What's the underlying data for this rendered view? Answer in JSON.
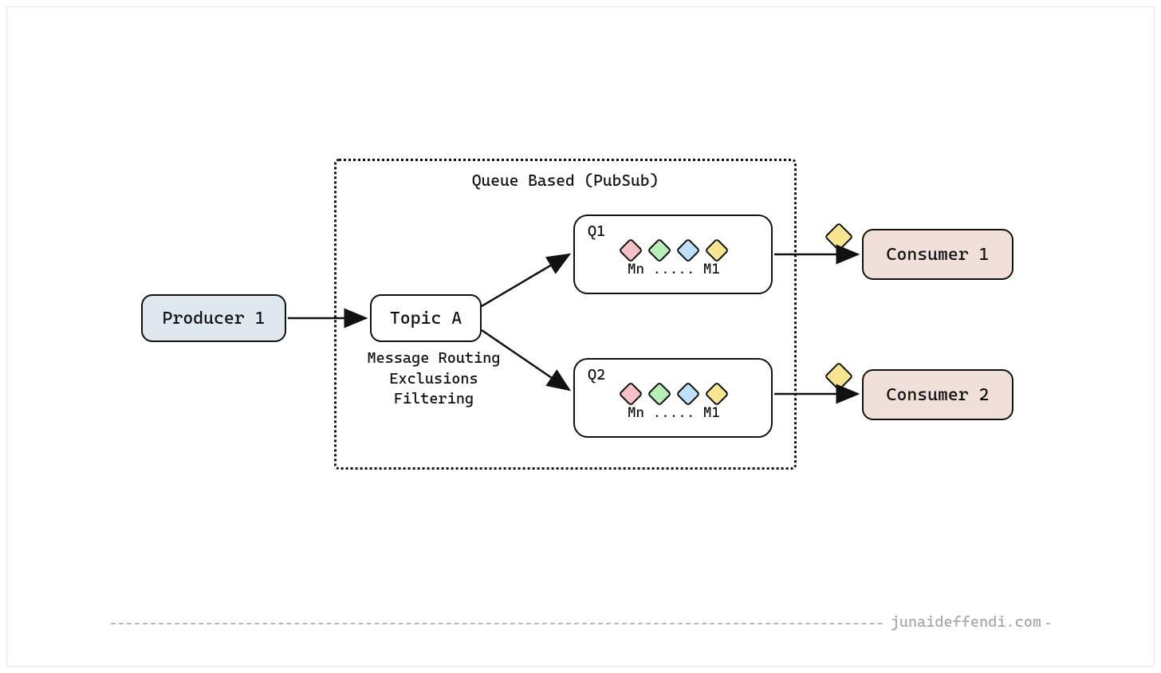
{
  "producer": {
    "label": "Producer 1"
  },
  "topic": {
    "label": "Topic A",
    "subtitle_line1": "Message Routing",
    "subtitle_line2": "Exclusions",
    "subtitle_line3": "Filtering"
  },
  "pubsub": {
    "title": "Queue Based (PubSub)"
  },
  "queues": {
    "q1": {
      "label": "Q1",
      "sub": "Mn ..... M1"
    },
    "q2": {
      "label": "Q2",
      "sub": "Mn ..... M1"
    }
  },
  "consumers": {
    "c1": {
      "label": "Consumer 1"
    },
    "c2": {
      "label": "Consumer 2"
    }
  },
  "messages": {
    "colors": [
      "pink",
      "green",
      "blue",
      "yellow"
    ],
    "floating_color": "yellow"
  },
  "footer": {
    "text": "junaideffendi.com"
  }
}
